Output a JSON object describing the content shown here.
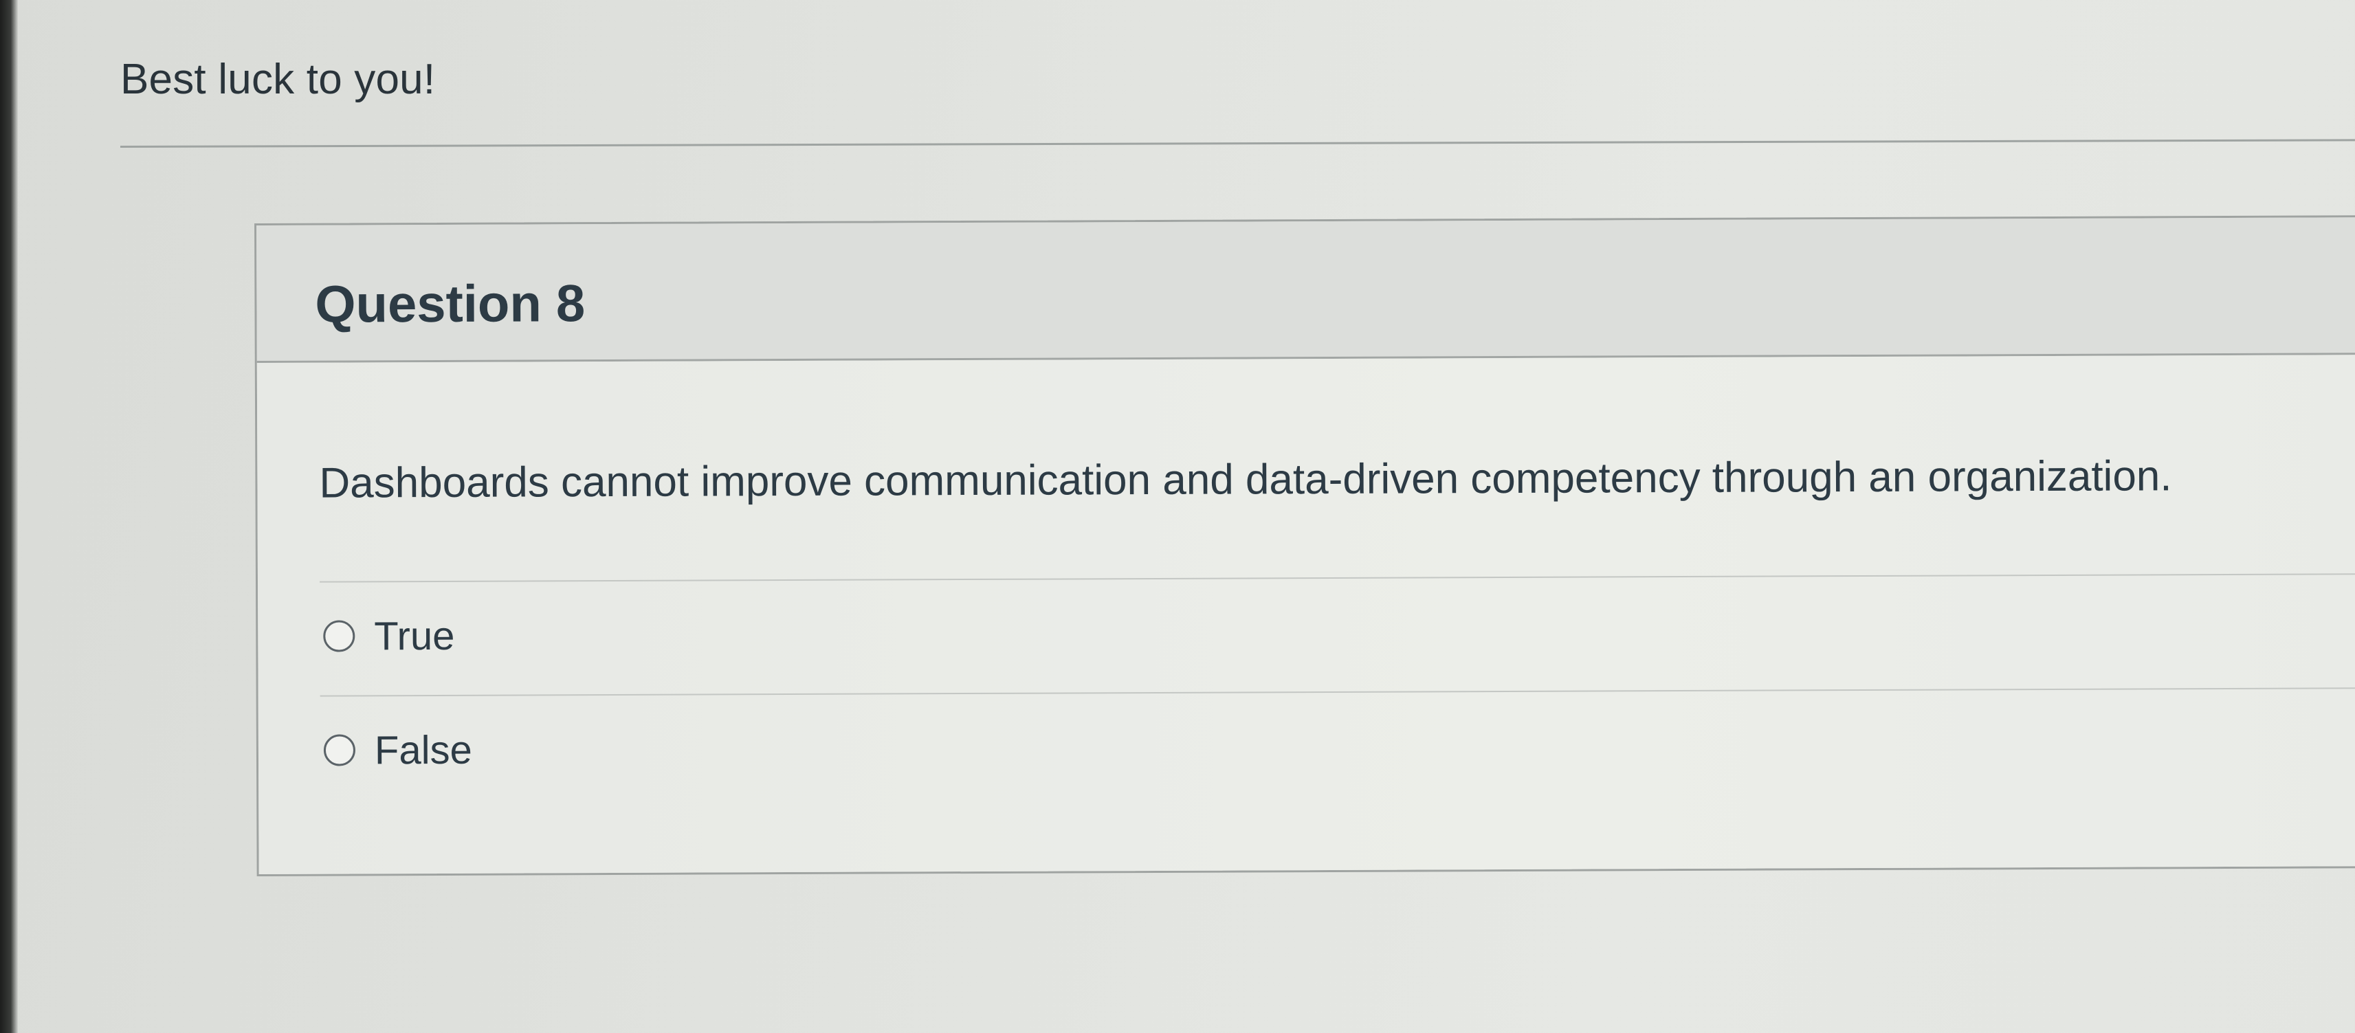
{
  "intro": {
    "text": "Best luck to you!"
  },
  "question": {
    "title": "Question 8",
    "text": "Dashboards cannot improve communication and data-driven competency through an organization.",
    "answers": [
      {
        "label": "True",
        "selected": false
      },
      {
        "label": "False",
        "selected": false
      }
    ]
  },
  "colors": {
    "text": "#2d3b45",
    "border": "#9fa3a1",
    "header_bg": "#dcdedb",
    "page_bg": "#e1e3df"
  }
}
